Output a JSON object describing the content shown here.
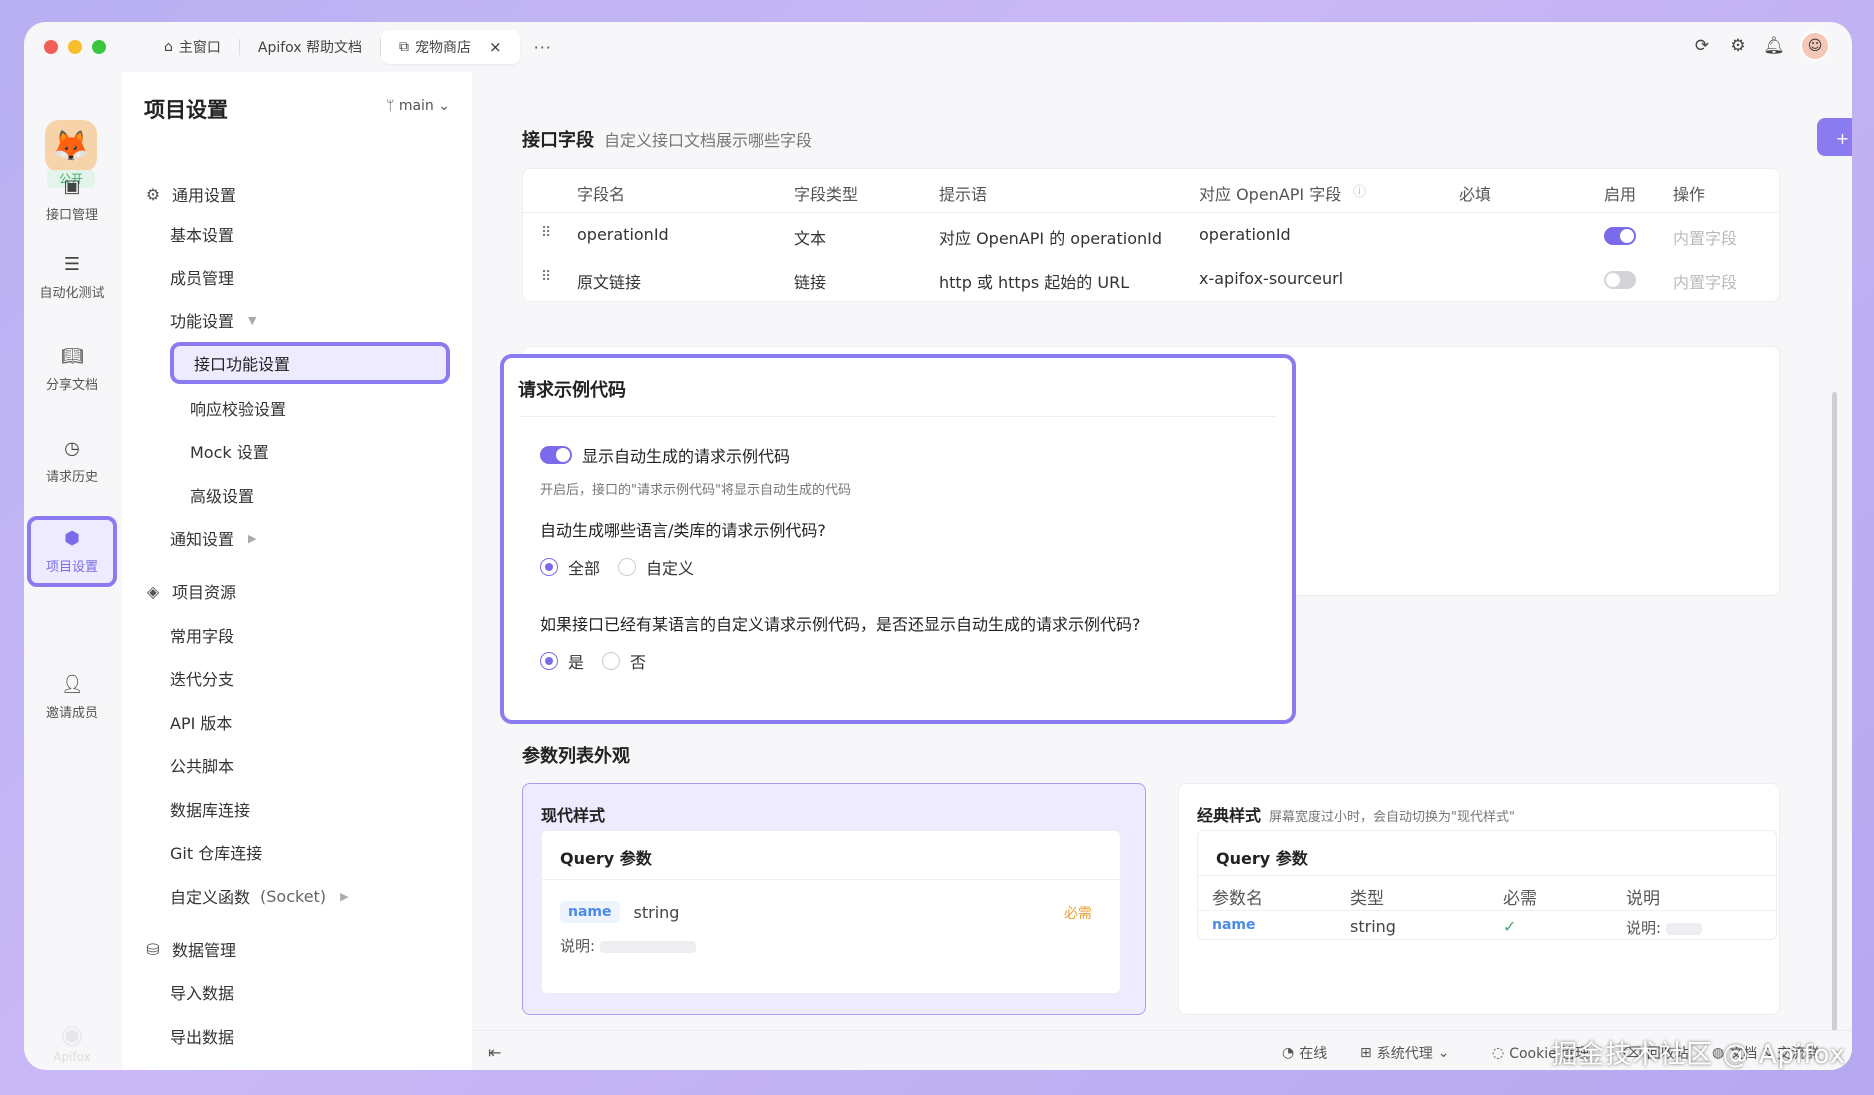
{
  "titlebar": {
    "tabs": [
      {
        "label": "主窗口",
        "icon": "home-icon"
      },
      {
        "label": "Apifox 帮助文档",
        "icon": ""
      },
      {
        "label": "宠物商店",
        "icon": "external-tab-icon",
        "active": true
      }
    ],
    "more": "···",
    "close": "×"
  },
  "rail": {
    "badge": "公开",
    "items": [
      {
        "label": "接口管理",
        "icon": "api-icon"
      },
      {
        "label": "自动化测试",
        "icon": "automation-icon"
      },
      {
        "label": "分享文档",
        "icon": "book-icon"
      },
      {
        "label": "请求历史",
        "icon": "clock-icon"
      },
      {
        "label": "项目设置",
        "icon": "settings-icon",
        "active": true
      },
      {
        "label": "邀请成员",
        "icon": "invite-icon"
      }
    ],
    "footer": "Apifox"
  },
  "nav": {
    "title": "项目设置",
    "branch": "main",
    "groups": {
      "general": "通用设置",
      "basic": "基本设置",
      "members": "成员管理",
      "features": "功能设置",
      "api_features": "接口功能设置",
      "response_validation": "响应校验设置",
      "mock": "Mock 设置",
      "advanced": "高级设置",
      "notify": "通知设置",
      "resources": "项目资源",
      "common_fields": "常用字段",
      "iteration": "迭代分支",
      "api_version": "API 版本",
      "public_script": "公共脚本",
      "db_conn": "数据库连接",
      "git_conn": "Git 仓库连接",
      "custom_func": "自定义函数",
      "custom_func_suffix": "(Socket)",
      "data_mgmt": "数据管理",
      "import": "导入数据",
      "export": "导出数据"
    }
  },
  "fields": {
    "title": "接口字段",
    "subtitle": "自定义接口文档展示哪些字段",
    "add_label": "+ 添加",
    "headers": [
      "字段名",
      "字段类型",
      "提示语",
      "对应 OpenAPI 字段",
      "必填",
      "启用",
      "操作"
    ],
    "rows": [
      {
        "name": "operationId",
        "type": "文本",
        "hint": "对应 OpenAPI 的 operationId",
        "openapi": "operationId",
        "enabled": true,
        "action": "内置字段"
      },
      {
        "name": "原文链接",
        "type": "链接",
        "hint": "http 或 https 起始的 URL",
        "openapi": "x-apifox-sourceurl",
        "enabled": false,
        "action": "内置字段"
      }
    ]
  },
  "code": {
    "title": "请求示例代码",
    "toggle_label": "显示自动生成的请求示例代码",
    "hint": "开启后，接口的\"请求示例代码\"将显示自动生成的代码",
    "q1": "自动生成哪些语言/类库的请求示例代码?",
    "q1_opts": [
      "全部",
      "自定义"
    ],
    "q2": "如果接口已经有某语言的自定义请求示例代码，是否还显示自动生成的请求示例代码?",
    "q2_opts": [
      "是",
      "否"
    ]
  },
  "appearance": {
    "title": "参数列表外观",
    "modern": {
      "title": "现代样式",
      "panel_title": "Query 参数",
      "param_name": "name",
      "param_type": "string",
      "required": "必需",
      "desc_label": "说明:"
    },
    "classic": {
      "title": "经典样式",
      "subtitle": "屏幕宽度过小时，会自动切换为\"现代样式\"",
      "panel_title": "Query 参数",
      "headers": [
        "参数名",
        "类型",
        "必需",
        "说明"
      ],
      "param_name": "name",
      "param_type": "string",
      "check": "✓",
      "desc_label": "说明:"
    }
  },
  "footer": {
    "collapse": "⇤",
    "online": "在线",
    "proxy": "系统代理",
    "cookie": "Cookie 管理",
    "recycle": "回收站",
    "docs": "文档 & 交流群"
  },
  "watermark": "掘金技术社区 @ Apifox",
  "colors": {
    "accent": "#8a7cf0",
    "accent_dark": "#7a6bea",
    "link_blue": "#4a8ae8",
    "required_orange": "#e8a23a",
    "check_green": "#3fb06b"
  }
}
